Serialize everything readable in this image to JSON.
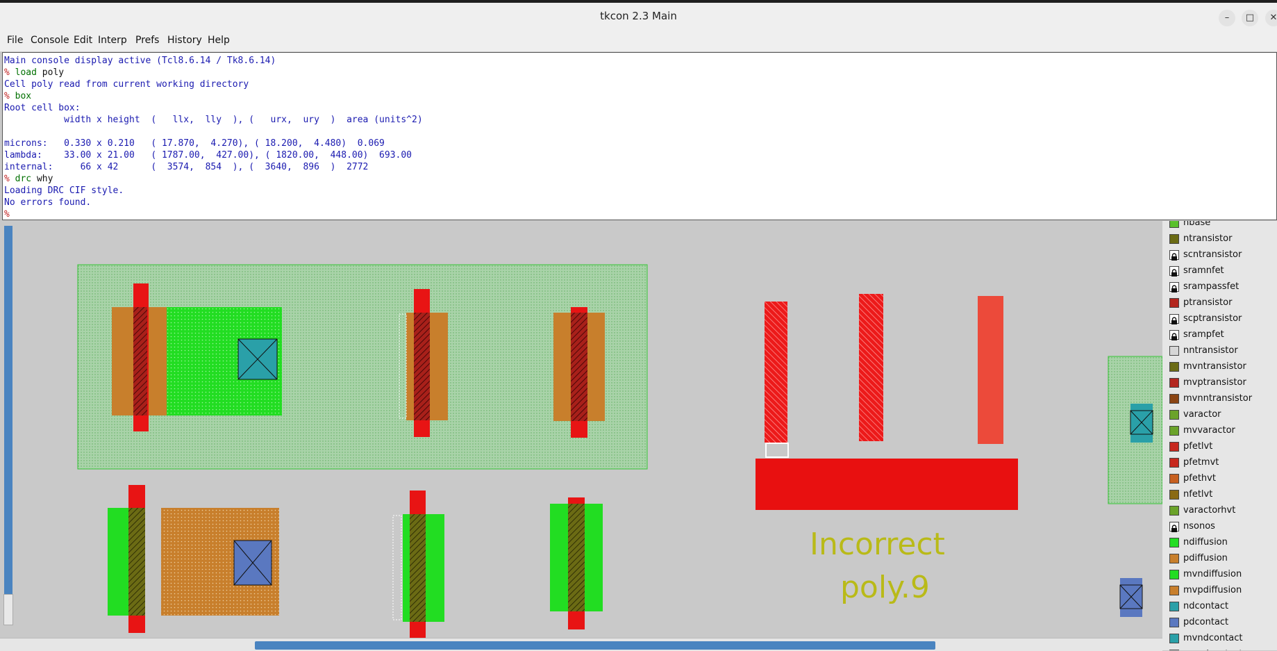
{
  "window": {
    "title": "tkcon 2.3 Main",
    "buttons": {
      "minimize": "–",
      "maximize": "□",
      "close": "✕"
    }
  },
  "menubar": {
    "items": [
      "File",
      "Console",
      "Edit",
      "Interp",
      "Prefs",
      "History",
      "Help"
    ]
  },
  "console": {
    "lines": [
      {
        "type": "info",
        "text": "Main console display active (Tcl8.6.14 / Tk8.6.14)"
      },
      {
        "type": "cmd",
        "prompt": "% ",
        "cmd": "load",
        "arg": " poly"
      },
      {
        "type": "info",
        "text": "Cell poly read from current working directory"
      },
      {
        "type": "cmd",
        "prompt": "% ",
        "cmd": "box",
        "arg": ""
      },
      {
        "type": "info",
        "text": "Root cell box:"
      },
      {
        "type": "info",
        "text": "           width x height  (   llx,  lly  ), (   urx,  ury  )  area (units^2)"
      },
      {
        "type": "info",
        "text": ""
      },
      {
        "type": "info",
        "text": "microns:   0.330 x 0.210   ( 17.870,  4.270), ( 18.200,  4.480)  0.069"
      },
      {
        "type": "info",
        "text": "lambda:    33.00 x 21.00   ( 1787.00,  427.00), ( 1820.00,  448.00)  693.00"
      },
      {
        "type": "info",
        "text": "internal:     66 x 42      (  3574,  854  ), (  3640,  896  )  2772"
      },
      {
        "type": "cmd",
        "prompt": "% ",
        "cmd": "drc",
        "arg": " why"
      },
      {
        "type": "info",
        "text": "Loading DRC CIF style."
      },
      {
        "type": "info",
        "text": "No errors found."
      },
      {
        "type": "cmd",
        "prompt": "%",
        "cmd": "",
        "arg": ""
      }
    ]
  },
  "layout_label": {
    "line1": "Incorrect",
    "line2": "poly.9"
  },
  "layers": [
    {
      "name": "nbase",
      "color": "#59c02b"
    },
    {
      "name": "ntransistor",
      "color": "#6b6b14"
    },
    {
      "name": "scntransistor",
      "color": "locked"
    },
    {
      "name": "sramnfet",
      "color": "locked"
    },
    {
      "name": "srampassfet",
      "color": "locked"
    },
    {
      "name": "ptransistor",
      "color": "#b3261e"
    },
    {
      "name": "scptransistor",
      "color": "locked"
    },
    {
      "name": "srampfet",
      "color": "locked"
    },
    {
      "name": "nntransistor",
      "color": "#d6d6d6"
    },
    {
      "name": "mvntransistor",
      "color": "#6b6b14"
    },
    {
      "name": "mvptransistor",
      "color": "#b3261e"
    },
    {
      "name": "mvnntransistor",
      "color": "#8b4513"
    },
    {
      "name": "varactor",
      "color": "#6ba32a"
    },
    {
      "name": "mvvaractor",
      "color": "#6ba32a"
    },
    {
      "name": "pfetlvt",
      "color": "#c7281e"
    },
    {
      "name": "pfetmvt",
      "color": "#c7281e"
    },
    {
      "name": "pfethvt",
      "color": "#c76020"
    },
    {
      "name": "nfetlvt",
      "color": "#8a6a14"
    },
    {
      "name": "varactorhvt",
      "color": "#6ba32a"
    },
    {
      "name": "nsonos",
      "color": "locked"
    },
    {
      "name": "ndiffusion",
      "color": "#22dd22"
    },
    {
      "name": "pdiffusion",
      "color": "#c87f2c"
    },
    {
      "name": "mvndiffusion",
      "color": "#22dd22"
    },
    {
      "name": "mvpdiffusion",
      "color": "#c87f2c"
    },
    {
      "name": "ndcontact",
      "color": "#2aa0a8"
    },
    {
      "name": "pdcontact",
      "color": "#5a78c0"
    },
    {
      "name": "mvndcontact",
      "color": "#2aa0a8"
    },
    {
      "name": "mvpdcontact",
      "color": "#5a78c0"
    }
  ]
}
